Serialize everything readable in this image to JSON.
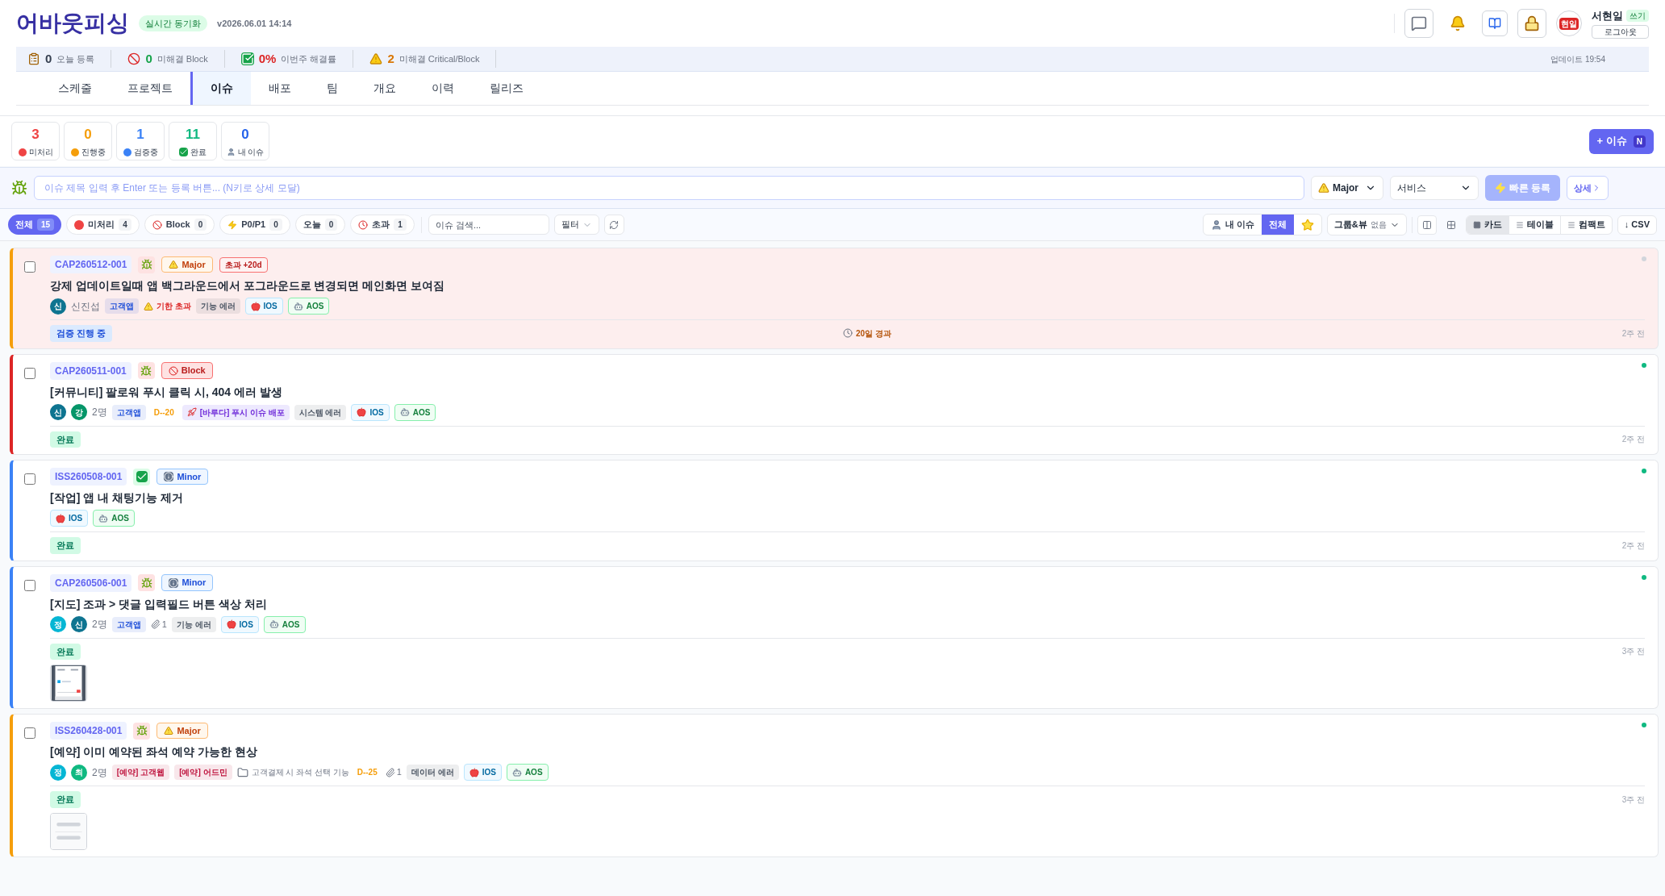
{
  "header": {
    "logo": "어바웃피싱",
    "sync_badge": "실시간 동기화",
    "version": "v2026.06.01 14:14",
    "user": {
      "avatar": "현일",
      "name": "서현일",
      "role": "쓰기",
      "logout": "로그아웃"
    }
  },
  "stats_bar": {
    "items": [
      {
        "kind": "today",
        "value": "0",
        "label": "오늘 등록"
      },
      {
        "kind": "block",
        "value": "0",
        "label": "미해결 Block"
      },
      {
        "kind": "rate",
        "value": "0%",
        "label": "이번주 해결률"
      },
      {
        "kind": "critical",
        "value": "2",
        "label": "미해결 Critical/Block"
      }
    ],
    "updated": "업데이트 19:54"
  },
  "tabs": [
    {
      "label": "스케줄",
      "selected": false
    },
    {
      "label": "프로젝트",
      "selected": false
    },
    {
      "label": "이슈",
      "selected": true
    },
    {
      "label": "배포",
      "selected": false
    },
    {
      "label": "팀",
      "selected": false
    },
    {
      "label": "개요",
      "selected": false
    },
    {
      "label": "이력",
      "selected": false
    },
    {
      "label": "릴리즈",
      "selected": false
    }
  ],
  "counters": [
    {
      "value": "3",
      "label": "미처리",
      "color": "#ef4444",
      "kind": "dot"
    },
    {
      "value": "0",
      "label": "진행중",
      "color": "#f59e0b",
      "kind": "dot"
    },
    {
      "value": "1",
      "label": "검증중",
      "color": "#3b82f6",
      "kind": "dot"
    },
    {
      "value": "11",
      "label": "완료",
      "color": "#10b981",
      "kind": "check"
    },
    {
      "value": "0",
      "label": "내 이슈",
      "color": "#2563eb",
      "kind": "user"
    }
  ],
  "new_issue_button": {
    "label": "+ 이슈",
    "shortcut": "N"
  },
  "quick_add": {
    "placeholder": "이슈 제목 입력 후 Enter 또는 등록 버튼... (N키로 상세 모달)",
    "severity": "Major",
    "service": "서비스",
    "submit": "빠른 등록",
    "detail": "상세"
  },
  "filters": [
    {
      "label": "전체",
      "count": "15",
      "selected": true,
      "kind": "plain"
    },
    {
      "label": "미처리",
      "count": "4",
      "selected": false,
      "kind": "dot"
    },
    {
      "label": "Block",
      "count": "0",
      "selected": false,
      "kind": "ban"
    },
    {
      "label": "P0/P1",
      "count": "0",
      "selected": false,
      "kind": "bolt"
    },
    {
      "label": "오늘",
      "count": "0",
      "selected": false,
      "kind": "plain"
    },
    {
      "label": "초과",
      "count": "1",
      "selected": false,
      "kind": "clock"
    }
  ],
  "search": {
    "placeholder": "이슈 검색..."
  },
  "filter_menu": "필터",
  "scope": [
    {
      "label": "내 이슈",
      "selected": false,
      "kind": "user"
    },
    {
      "label": "전체",
      "selected": true,
      "kind": "text"
    },
    {
      "selected": false,
      "kind": "star"
    }
  ],
  "group_view": {
    "label": "그룹&뷰",
    "value": "없음"
  },
  "views": [
    {
      "label": "카드",
      "selected": true
    },
    {
      "label": "테이블",
      "selected": false
    },
    {
      "label": "컴팩트",
      "selected": false
    }
  ],
  "csv": "↓ CSV",
  "issues": [
    {
      "id": "CAP260512-001",
      "kind": "bug",
      "severity": {
        "kind": "major",
        "label": "Major"
      },
      "overdue_badge": "초과 +20d",
      "title": "강제 업데이트일때 앱 백그라운드에서 포그라운드로 변경되면 메인화면 보여짐",
      "color": "#f59e0b",
      "highlighted": true,
      "dot": {
        "color": "#d1d5db"
      },
      "checked": false,
      "meta": [
        {
          "kind": "avatar",
          "label": "신",
          "color": "#0e7490"
        },
        {
          "kind": "text",
          "label": "신진섭"
        },
        {
          "kind": "tag",
          "color": "#1d4ed8",
          "label": "고객앱"
        },
        {
          "kind": "warning",
          "label": "기한 초과"
        },
        {
          "kind": "tag",
          "color": "#4b5563",
          "label": "기능 에러"
        },
        {
          "kind": "ios",
          "label": "IOS"
        },
        {
          "kind": "aos",
          "label": "AOS"
        }
      ],
      "status": {
        "kind": "verifying",
        "label": "검증 진행 중"
      },
      "elapsed": "20일 경과",
      "time": "2주 전"
    },
    {
      "id": "CAP260511-001",
      "kind": "bug",
      "severity": {
        "kind": "block",
        "label": "Block"
      },
      "title": "[커뮤니티] 팔로워 푸시 클릭 시, 404 에러 발생",
      "color": "#dc2626",
      "highlighted": false,
      "dot": {
        "color": "#10b981"
      },
      "checked": false,
      "meta": [
        {
          "kind": "avatar",
          "label": "신",
          "color": "#0e7490"
        },
        {
          "kind": "avatar",
          "label": "강",
          "color": "#059669"
        },
        {
          "kind": "text",
          "label": "2명"
        },
        {
          "kind": "tag",
          "color": "#1d4ed8",
          "label": "고객앱"
        },
        {
          "kind": "deadline",
          "label": "D--20"
        },
        {
          "kind": "rocket",
          "label": "[바루다] 푸시 이슈 배포"
        },
        {
          "kind": "tag",
          "color": "#4b5563",
          "label": "시스템 에러"
        },
        {
          "kind": "ios",
          "label": "IOS"
        },
        {
          "kind": "aos",
          "label": "AOS"
        }
      ],
      "status": {
        "kind": "done",
        "label": "완료"
      },
      "time": "2주 전"
    },
    {
      "id": "ISS260508-001",
      "kind": "task",
      "severity": {
        "kind": "minor",
        "label": "Minor"
      },
      "title": "[작업] 앱 내 채팅기능 제거",
      "color": "#3b82f6",
      "highlighted": false,
      "dot": {
        "color": "#10b981"
      },
      "checked": false,
      "meta": [
        {
          "kind": "ios",
          "label": "IOS"
        },
        {
          "kind": "aos",
          "label": "AOS"
        }
      ],
      "status": {
        "kind": "done",
        "label": "완료"
      },
      "time": "2주 전"
    },
    {
      "id": "CAP260506-001",
      "kind": "bug",
      "severity": {
        "kind": "minor",
        "label": "Minor"
      },
      "title": "[지도] 조과 > 댓글 입력필드 버튼 색상 처리",
      "color": "#3b82f6",
      "highlighted": false,
      "dot": {
        "color": "#10b981"
      },
      "checked": false,
      "meta": [
        {
          "kind": "avatar",
          "label": "정",
          "color": "#06b6d4"
        },
        {
          "kind": "avatar",
          "label": "신",
          "color": "#0e7490"
        },
        {
          "kind": "text",
          "label": "2명"
        },
        {
          "kind": "tag",
          "color": "#1d4ed8",
          "label": "고객앱"
        },
        {
          "kind": "attach",
          "label": "1"
        },
        {
          "kind": "tag",
          "color": "#4b5563",
          "label": "기능 에러"
        },
        {
          "kind": "ios",
          "label": "IOS"
        },
        {
          "kind": "aos",
          "label": "AOS"
        }
      ],
      "status": {
        "kind": "done",
        "label": "완료"
      },
      "time": "3주 전",
      "attachment": {
        "kind": "picture"
      }
    },
    {
      "id": "ISS260428-001",
      "kind": "bug",
      "severity": {
        "kind": "major",
        "label": "Major"
      },
      "title": "[예약] 이미 예약된 좌석 예약 가능한 현상",
      "color": "#f59e0b",
      "highlighted": false,
      "dot": {
        "color": "#10b981"
      },
      "checked": false,
      "meta": [
        {
          "kind": "avatar",
          "label": "정",
          "color": "#06b6d4"
        },
        {
          "kind": "avatar",
          "label": "최",
          "color": "#10b981"
        },
        {
          "kind": "text",
          "label": "2명"
        },
        {
          "kind": "tag",
          "color": "#be123c",
          "label": "[예약] 고객웹"
        },
        {
          "kind": "tag",
          "color": "#be123c",
          "label": "[예약] 어드민"
        },
        {
          "kind": "folder",
          "label": "고객결제 시 좌석 선택 기능"
        },
        {
          "kind": "deadline",
          "label": "D--25"
        },
        {
          "kind": "attach",
          "label": "1"
        },
        {
          "kind": "tag",
          "color": "#4b5563",
          "label": "데이터 에러"
        },
        {
          "kind": "ios",
          "label": "IOS"
        },
        {
          "kind": "aos",
          "label": "AOS"
        }
      ],
      "status": {
        "kind": "done",
        "label": "완료"
      },
      "time": "3주 전",
      "attachment": {
        "kind": "picture"
      }
    }
  ]
}
